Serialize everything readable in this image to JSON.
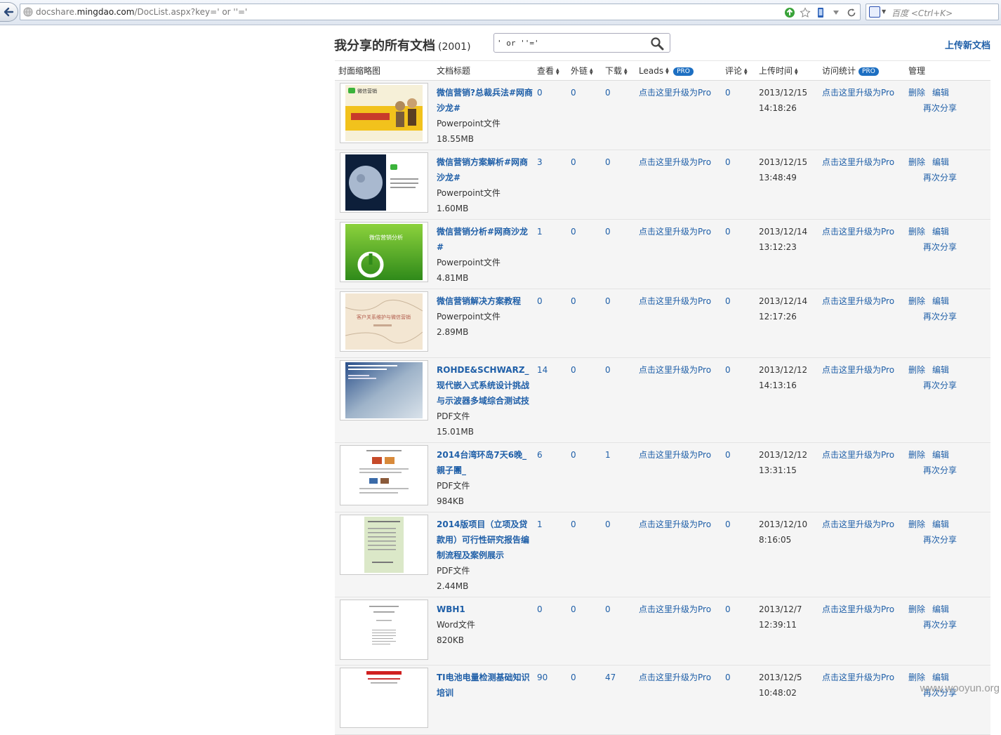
{
  "browser": {
    "url_prefix": "docshare.",
    "url_domain": "mingdao.com",
    "url_path": "/DocList.aspx?key=' or ''='",
    "search_placeholder": "百度 <Ctrl+K>",
    "icons": [
      "back-arrow-icon",
      "globe-icon",
      "green-go-icon",
      "star-icon",
      "mobile-icon",
      "dropdown-icon",
      "refresh-icon",
      "baidu-paw-icon"
    ]
  },
  "header": {
    "title": "我分享的所有文档",
    "count": "(2001)",
    "search_value": "' or ''='",
    "upload_label": "上传新文档"
  },
  "table": {
    "columns": {
      "thumb": "封面缩略图",
      "title": "文档标题",
      "views": "查看",
      "external": "外链",
      "downloads": "下载",
      "leads": "Leads",
      "comments": "评论",
      "upload_time": "上传时间",
      "stats": "访问统计",
      "manage": "管理"
    },
    "pro_badge": "PRO",
    "upgrade_label": "点击这里升级为Pro",
    "delete_label": "删除",
    "edit_label": "编辑",
    "reshare_label": "再次分享",
    "rows": [
      {
        "title": "微信营销?总裁兵法#网商沙龙#",
        "type": "Powerpoint文件",
        "size": "18.55MB",
        "views": "0",
        "external": "0",
        "downloads": "0",
        "comments": "0",
        "date": "2013/12/15",
        "time": "14:18:26"
      },
      {
        "title": "微信营销方案解析#网商沙龙#",
        "type": "Powerpoint文件",
        "size": "1.60MB",
        "views": "3",
        "external": "0",
        "downloads": "0",
        "comments": "0",
        "date": "2013/12/15",
        "time": "13:48:49"
      },
      {
        "title": "微信营销分析#网商沙龙#",
        "type": "Powerpoint文件",
        "size": "4.81MB",
        "views": "1",
        "external": "0",
        "downloads": "0",
        "comments": "0",
        "date": "2013/12/14",
        "time": "13:12:23"
      },
      {
        "title": "微信营销解决方案教程",
        "type": "Powerpoint文件",
        "size": "2.89MB",
        "views": "0",
        "external": "0",
        "downloads": "0",
        "comments": "0",
        "date": "2013/12/14",
        "time": "12:17:26"
      },
      {
        "title": "ROHDE&SCHWARZ_现代嵌入式系统设计挑战与示波器多域综合测试技",
        "type": "PDF文件",
        "size": "15.01MB",
        "views": "14",
        "external": "0",
        "downloads": "0",
        "comments": "0",
        "date": "2013/12/12",
        "time": "14:13:16"
      },
      {
        "title": "2014台湾环岛7天6晚_親子團_",
        "type": "PDF文件",
        "size": "984KB",
        "views": "6",
        "external": "0",
        "downloads": "1",
        "comments": "0",
        "date": "2013/12/12",
        "time": "13:31:15"
      },
      {
        "title": "2014版项目（立项及贷款用）可行性研究报告编制流程及案例展示",
        "type": "PDF文件",
        "size": "2.44MB",
        "views": "1",
        "external": "0",
        "downloads": "0",
        "comments": "0",
        "date": "2013/12/10",
        "time": "8:16:05"
      },
      {
        "title": "WBH1",
        "type": "Word文件",
        "size": "820KB",
        "views": "0",
        "external": "0",
        "downloads": "0",
        "comments": "0",
        "date": "2013/12/7",
        "time": "12:39:11"
      },
      {
        "title": "TI电池电量检测基础知识培训",
        "type": "",
        "size": "",
        "views": "90",
        "external": "0",
        "downloads": "47",
        "comments": "0",
        "date": "2013/12/5",
        "time": "10:48:02"
      }
    ]
  },
  "thumb_text": {
    "t1": "微信营销",
    "t3": "微信营销分析",
    "t4": "客户关系维护与微信营销"
  },
  "watermark": "www.wooyun.org"
}
